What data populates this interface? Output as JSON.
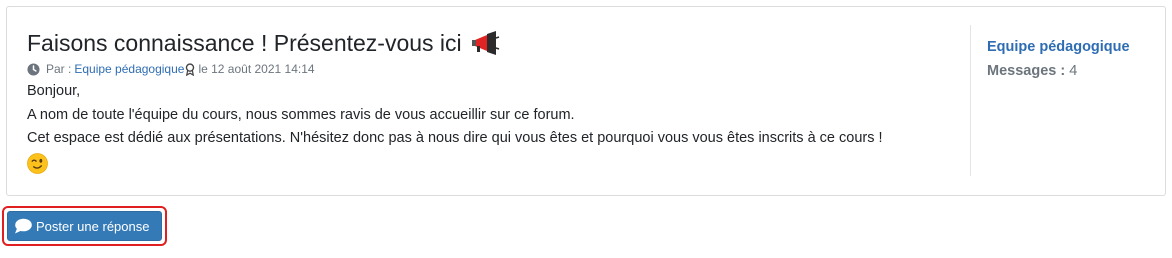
{
  "post": {
    "title": "Faisons connaissance ! Présentez-vous ici",
    "meta_prefix": "Par :",
    "author": "Equipe pédagogique",
    "date": "le 12 août 2021 14:14",
    "body": [
      "Bonjour,",
      "A nom de toute l'équipe du cours, nous sommes ravis de vous accueillir sur ce forum.",
      "Cet espace est dédié aux présentations. N'hésitez donc pas à nous dire qui vous êtes et pourquoi vous vous êtes inscrits à ce cours !"
    ]
  },
  "sidebar": {
    "author": "Equipe pédagogique",
    "messages_label": "Messages :",
    "messages_count": "4"
  },
  "reply_button": {
    "label": "Poster une réponse"
  },
  "colors": {
    "link": "#2f6db3",
    "button": "#337ab7",
    "highlight": "#e02020",
    "megaphone": "#e02424"
  },
  "icons": [
    "megaphone-icon",
    "clock-icon",
    "award-icon",
    "wink-emoji-icon",
    "speech-bubble-icon"
  ]
}
